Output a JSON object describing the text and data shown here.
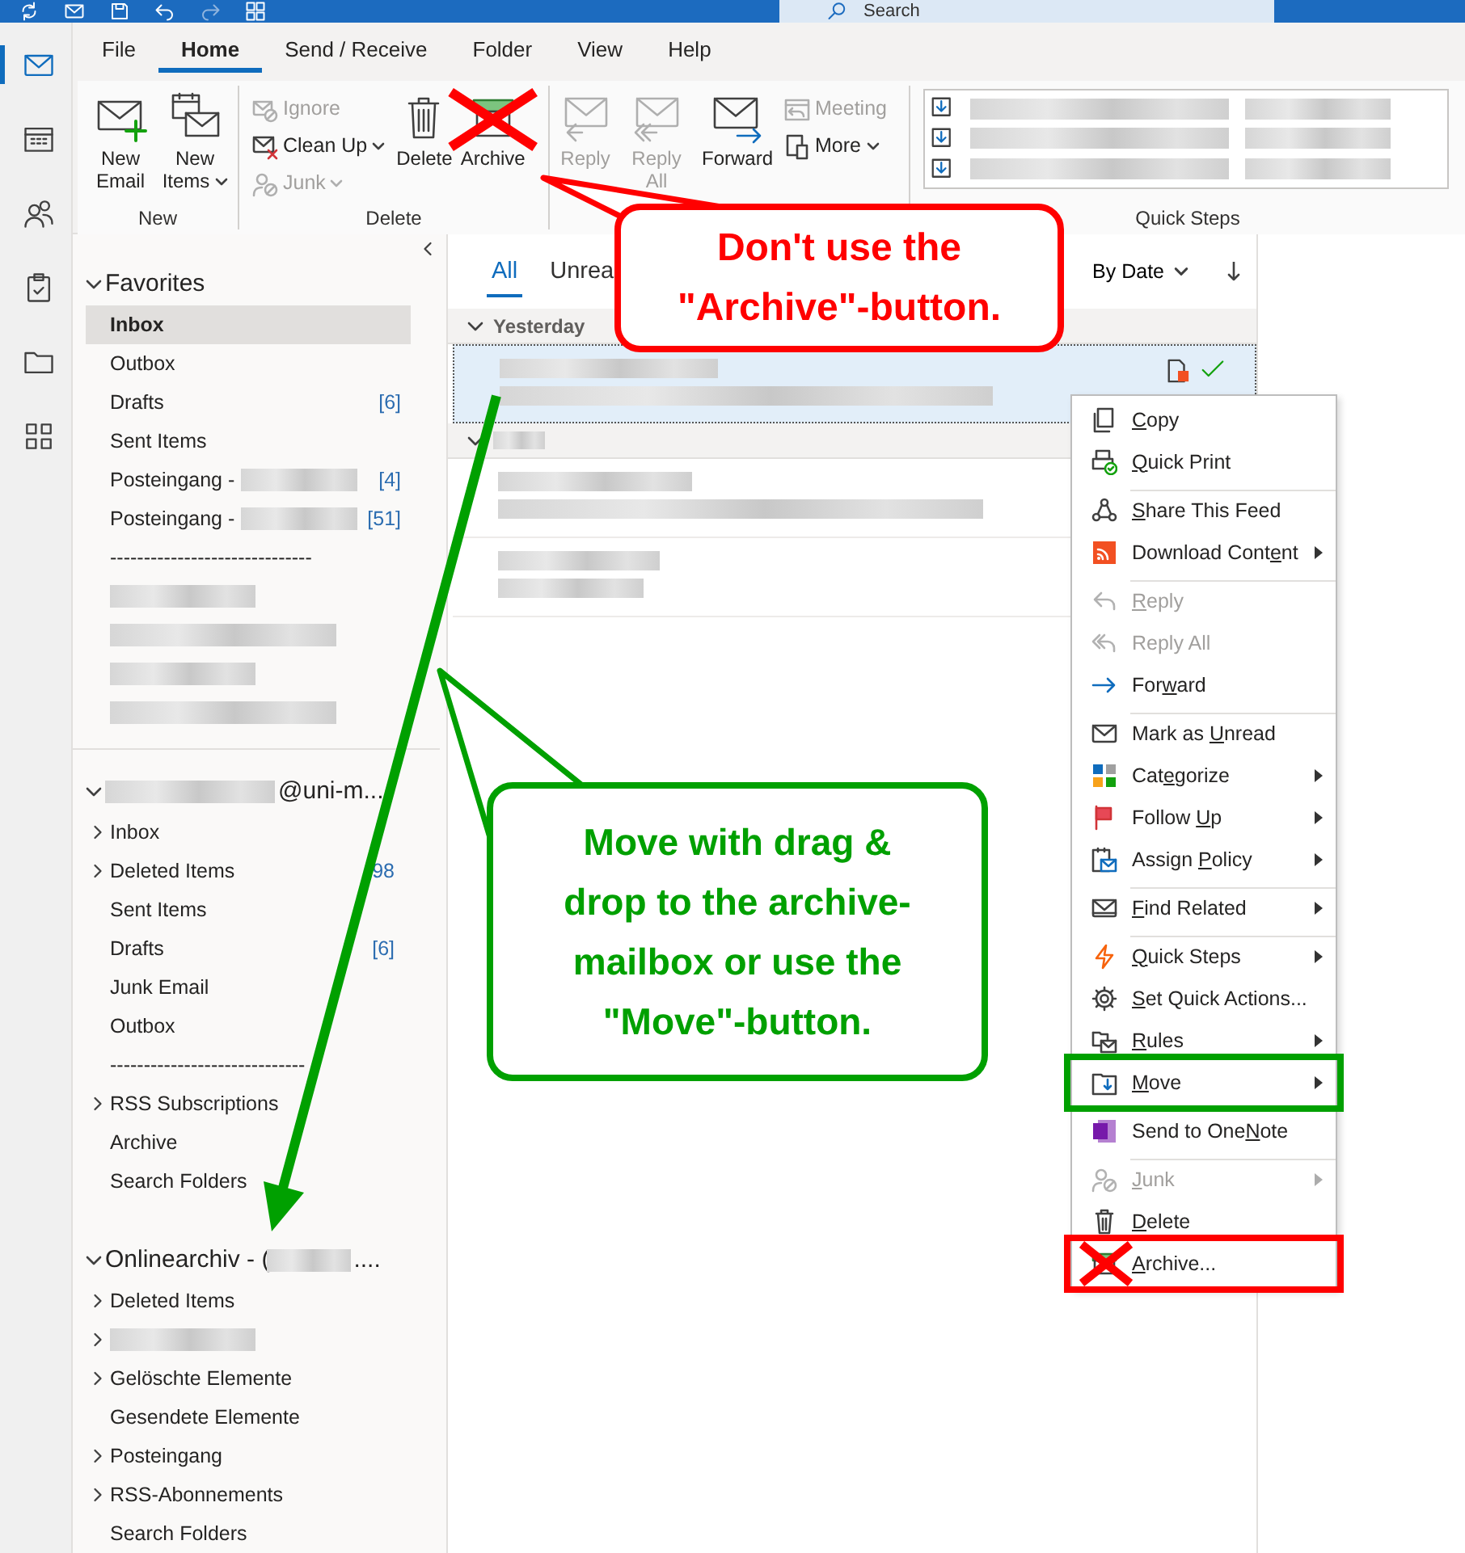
{
  "title_bar": {
    "search": {
      "placeholder": "Search"
    }
  },
  "nav_rail": [
    {
      "selected": true
    },
    {
      "selected": false
    },
    {
      "selected": false
    },
    {
      "selected": false
    },
    {
      "selected": false
    },
    {
      "selected": false
    }
  ],
  "ribbon": {
    "tabs": [
      {
        "label": "File",
        "selected": false
      },
      {
        "label": "Home",
        "selected": true
      },
      {
        "label": "Send / Receive",
        "selected": false
      },
      {
        "label": "Folder",
        "selected": false
      },
      {
        "label": "View",
        "selected": false
      },
      {
        "label": "Help",
        "selected": false
      }
    ],
    "groups": [
      {
        "kind": "buttons",
        "label": "New",
        "buttons": [
          {
            "kind": "large",
            "label": "New Email",
            "disabled": false,
            "dropdown": false,
            "crossed": false
          },
          {
            "kind": "large",
            "label": "New Items",
            "disabled": false,
            "dropdown": true,
            "crossed": false
          }
        ]
      },
      {
        "kind": "buttons",
        "label": "Delete",
        "buttons": [
          {
            "kind": "small",
            "label": "Ignore",
            "disabled": true,
            "dropdown": false,
            "crossed": false
          },
          {
            "kind": "small",
            "label": "Clean Up",
            "disabled": false,
            "dropdown": true,
            "crossed": false
          },
          {
            "kind": "small",
            "label": "Junk",
            "disabled": true,
            "dropdown": true,
            "crossed": false
          },
          {
            "kind": "large",
            "label": "Delete",
            "disabled": false,
            "dropdown": false,
            "crossed": false
          },
          {
            "kind": "large",
            "label": "Archive",
            "disabled": false,
            "dropdown": false,
            "crossed": true
          }
        ]
      },
      {
        "kind": "buttons",
        "buttons": [
          {
            "kind": "large",
            "label": "Reply",
            "disabled": true,
            "dropdown": false,
            "crossed": false
          },
          {
            "kind": "large",
            "label": "Reply All",
            "disabled": true,
            "dropdown": false,
            "crossed": false
          },
          {
            "kind": "large",
            "label": "Forward",
            "disabled": false,
            "dropdown": false,
            "crossed": false
          },
          {
            "kind": "small",
            "label": "Meeting",
            "disabled": true,
            "dropdown": false,
            "crossed": false
          },
          {
            "kind": "small",
            "label": "More",
            "disabled": false,
            "dropdown": true,
            "crossed": false
          }
        ]
      },
      {
        "kind": "gallery",
        "label": "Quick Steps"
      }
    ]
  },
  "folder_pane": {
    "sections": [
      {
        "title": "Favorites",
        "expanded": true,
        "redacted_before": false,
        "redacted_after": false,
        "items": [
          {
            "label": "Inbox",
            "selected": true,
            "expandable": false
          },
          {
            "label": "Outbox",
            "selected": false,
            "expandable": false
          },
          {
            "label": "Drafts",
            "count": "[6]",
            "selected": false,
            "expandable": false
          },
          {
            "label": "Sent Items",
            "selected": false,
            "expandable": false
          },
          {
            "label": "Posteingang -",
            "redacted": true,
            "count": "[4]",
            "selected": false,
            "expandable": false
          },
          {
            "label": "Posteingang -",
            "redacted": true,
            "count": "[51]",
            "selected": false,
            "expandable": false
          },
          {
            "kind": "separator",
            "label": "------------------------------",
            "selected": false,
            "expandable": false
          },
          {
            "kind": "redacted",
            "selected": false,
            "expandable": false
          },
          {
            "kind": "redacted",
            "selected": false,
            "expandable": false
          },
          {
            "kind": "redacted",
            "selected": false,
            "expandable": false
          },
          {
            "kind": "redacted",
            "selected": false,
            "expandable": false
          }
        ]
      },
      {
        "title": "@uni-m...",
        "redacted_before": true,
        "redacted_after": false,
        "expanded": true,
        "items": [
          {
            "label": "Inbox",
            "selected": false,
            "expandable": true
          },
          {
            "label": "Deleted Items",
            "count": "98",
            "selected": false,
            "expandable": true
          },
          {
            "label": "Sent Items",
            "selected": false,
            "expandable": false
          },
          {
            "label": "Drafts",
            "count": "[6]",
            "selected": false,
            "expandable": false
          },
          {
            "label": "Junk Email",
            "selected": false,
            "expandable": false
          },
          {
            "label": "Outbox",
            "selected": false,
            "expandable": false
          },
          {
            "kind": "separator",
            "label": "-----------------------------",
            "selected": false,
            "expandable": false
          },
          {
            "label": "RSS Subscriptions",
            "selected": false,
            "expandable": true
          },
          {
            "label": "Archive",
            "selected": false,
            "expandable": false
          },
          {
            "label": "Search Folders",
            "selected": false,
            "expandable": false
          }
        ]
      },
      {
        "title": "Onlinearchiv - (",
        "redacted_before": false,
        "redacted_after": true,
        "title_end": "....",
        "expanded": true,
        "items": [
          {
            "label": "Deleted Items",
            "selected": false,
            "expandable": true
          },
          {
            "kind": "redacted",
            "selected": false,
            "expandable": true
          },
          {
            "label": "Gelöschte Elemente",
            "selected": false,
            "expandable": true
          },
          {
            "label": "Gesendete Elemente",
            "selected": false,
            "expandable": false
          },
          {
            "label": "Posteingang",
            "selected": false,
            "expandable": true
          },
          {
            "label": "RSS-Abonnements",
            "selected": false,
            "expandable": true
          },
          {
            "label": "Search Folders",
            "selected": false,
            "expandable": false
          }
        ]
      }
    ]
  },
  "message_list": {
    "filters": [
      {
        "label": "All",
        "selected": true
      },
      {
        "label": "Unrea",
        "selected": false
      }
    ],
    "sort": {
      "label": "By Date"
    },
    "groups": [
      {
        "label": "Yesterday",
        "redacted": false,
        "expanded": true,
        "messages": [
          {
            "selected": true,
            "feed": true
          }
        ]
      },
      {
        "redacted": true,
        "expanded": true,
        "messages": [
          {
            "selected": false,
            "feed": false
          },
          {
            "selected": false,
            "feed": false
          }
        ]
      }
    ]
  },
  "context_menu": {
    "items": [
      {
        "label": "Copy",
        "disabled": false,
        "submenu": false,
        "separator_before": false
      },
      {
        "label": "Quick Print",
        "disabled": false,
        "submenu": false,
        "separator_before": false
      },
      {
        "label": "Share This Feed",
        "disabled": false,
        "submenu": false,
        "separator_before": true
      },
      {
        "label": "Download Content",
        "disabled": false,
        "submenu": true,
        "separator_before": false
      },
      {
        "label": "Reply",
        "disabled": true,
        "submenu": false,
        "separator_before": true
      },
      {
        "label": "Reply All",
        "disabled": true,
        "submenu": false,
        "separator_before": false
      },
      {
        "label": "Forward",
        "disabled": false,
        "submenu": false,
        "separator_before": false
      },
      {
        "label": "Mark as Unread",
        "disabled": false,
        "submenu": false,
        "separator_before": true
      },
      {
        "label": "Categorize",
        "disabled": false,
        "submenu": true,
        "separator_before": false
      },
      {
        "label": "Follow Up",
        "disabled": false,
        "submenu": true,
        "separator_before": false
      },
      {
        "label": "Assign Policy",
        "disabled": false,
        "submenu": true,
        "separator_before": false
      },
      {
        "label": "Find Related",
        "disabled": false,
        "submenu": true,
        "separator_before": true
      },
      {
        "label": "Quick Steps",
        "disabled": false,
        "submenu": true,
        "separator_before": true
      },
      {
        "label": "Set Quick Actions...",
        "disabled": false,
        "submenu": false,
        "separator_before": false
      },
      {
        "label": "Rules",
        "disabled": false,
        "submenu": true,
        "separator_before": false
      },
      {
        "label": "Move",
        "disabled": false,
        "submenu": true,
        "separator_before": false,
        "color": "#00a000"
      },
      {
        "label": "Send to OneNote",
        "disabled": false,
        "submenu": false,
        "separator_before": true
      },
      {
        "label": "Junk",
        "disabled": true,
        "submenu": true,
        "separator_before": true
      },
      {
        "label": "Delete",
        "disabled": false,
        "submenu": false,
        "separator_before": false
      },
      {
        "label": "Archive...",
        "disabled": false,
        "submenu": false,
        "separator_before": false,
        "color": "#ff0000",
        "crossed": true
      }
    ]
  },
  "annotations": [
    {
      "kind": "callout",
      "color": "#ff0000",
      "text": "Don't use the \"Archive\"-button."
    },
    {
      "kind": "callout",
      "color": "#00a000",
      "text": "Move with drag & drop to the archive-mailbox or use the \"Move\"-button."
    },
    {
      "kind": "arrow",
      "color": "#00a000"
    }
  ]
}
